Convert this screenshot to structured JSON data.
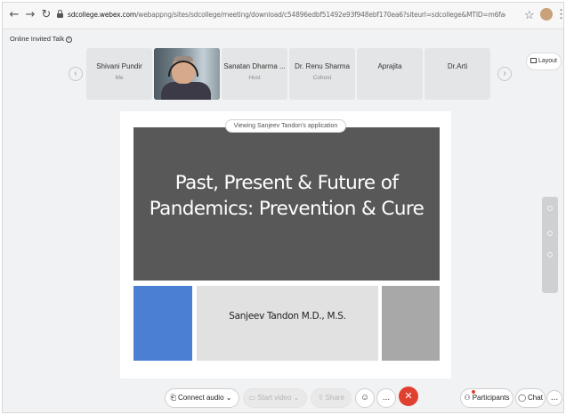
{
  "browser": {
    "back_icon": "arrow-left-icon",
    "forward_icon": "arrow-right-icon",
    "reload_icon": "reload-icon",
    "url_host": "sdcollege.webex.com",
    "url_path": "/webappng/sites/sdcollege/meeting/download/c54896edbf51492e93f948ebf170ea6?siteurl=sdcollege&MTID=m6fadb92ee45a228a097a55a67ce6c7b5"
  },
  "meeting": {
    "title": "Online Invited Talk",
    "info_icon": "i"
  },
  "participants_strip": [
    {
      "name": "Shivani Pundir",
      "role": "Me"
    },
    {
      "name": "",
      "role": ""
    },
    {
      "name": "Sanatan Dharma ...",
      "role": "Host"
    },
    {
      "name": "Dr. Renu Sharma",
      "role": "Cohost"
    },
    {
      "name": "Aprajita",
      "role": ""
    },
    {
      "name": "Dr.Arti",
      "role": ""
    }
  ],
  "layout_label": "Layout",
  "viewing_label": "Viewing Sanjeev Tandon's application",
  "slide": {
    "title_line1": "Past, Present & Future of",
    "title_line2": "Pandemics: Prevention & Cure",
    "presenter": "Sanjeev Tandon M.D., M.S."
  },
  "controls": {
    "connect_audio": "Connect audio",
    "start_video": "Start video",
    "share": "Share",
    "participants": "Participants",
    "chat": "Chat",
    "more": "..."
  },
  "colors": {
    "slide_bg": "#585858",
    "blue_tile": "#4a7fd4",
    "end_call": "#e0402f"
  }
}
